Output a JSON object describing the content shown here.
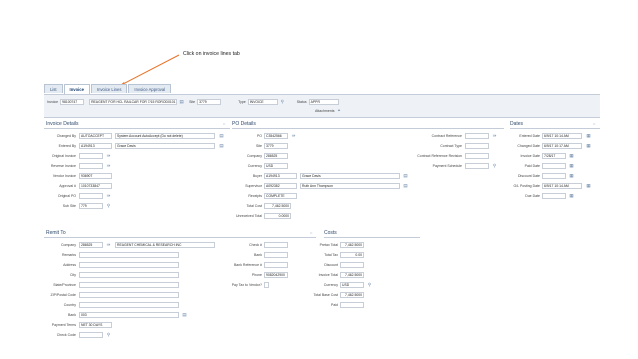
{
  "annotation": "Click on invoice lines tab",
  "tabs": [
    "List",
    "Invoice",
    "Invoice Lines",
    "Invoice Approval"
  ],
  "header": {
    "invoice_label": "Invoice",
    "invoice_value": "98100747",
    "description_value": "REAGENT FOR HCL RAILCAR FOR 7/15 ROROD0101",
    "site_label": "Site",
    "site_value": "3779",
    "type_label": "Type",
    "type_value": "INVOICE",
    "status_label": "Status",
    "status_value": "APPR",
    "attachments_label": "Attachments"
  },
  "invoice_details": {
    "title": "Invoice Details",
    "changed_by_label": "Changed By",
    "changed_by_value": "AUTOACCEPT",
    "changed_by_desc": "System Account AutoAccept (Do not delete)",
    "entered_by_label": "Entered By",
    "entered_by_value": "A194913",
    "entered_by_desc": "Grace Davis",
    "original_invoice_label": "Original Invoice",
    "reverse_invoice_label": "Reverse Invoice",
    "vendor_invoice_label": "Vendor Invoice",
    "vendor_invoice_value": "93690T",
    "approval_label": "Approval #",
    "approval_value": "1010733847",
    "original_po_label": "Original PO",
    "sub_site_label": "Sub Site",
    "sub_site_value": "779"
  },
  "po_details": {
    "title": "PO Details",
    "po_label": "PO",
    "po_value": "C3542566",
    "site_label": "Site",
    "site_value": "3779",
    "company_label": "Company",
    "company_value": "286525",
    "currency_label": "Currency",
    "currency_value": "USD",
    "buyer_label": "Buyer",
    "buyer_value": "A194913",
    "buyer_desc": "Grace Davis",
    "supervisor_label": "Supervisor",
    "supervisor_value": "A092382",
    "supervisor_desc": "Ruth Ann Thompson",
    "receipts_label": "Receipts",
    "receipts_value": "COMPLETE",
    "total_cost_label": "Total Cost",
    "total_cost_value": "7,462.5000",
    "unreceived_total_label": "Unreceived Total",
    "unreceived_total_value": "0.0000",
    "contract_reference_label": "Contract Reference",
    "contract_type_label": "Contract Type",
    "contract_revision_label": "Contract Reference Revision",
    "payment_schedule_label": "Payment Schedule"
  },
  "dates": {
    "title": "Dates",
    "entered_date_label": "Entered Date",
    "entered_date_value": "6/9/17 10:14 AM",
    "changed_date_label": "Changed Date",
    "changed_date_value": "6/9/17 10:17 AM",
    "invoice_date_label": "Invoice Date",
    "invoice_date_value": "7/28/17",
    "paid_date_label": "Paid Date",
    "discount_date_label": "Discount Date",
    "gl_posting_date_label": "G/L Posting Date",
    "gl_posting_date_value": "6/9/17 10:14 AM",
    "due_date_label": "Due Date"
  },
  "remit_to": {
    "title": "Remit To",
    "company_label": "Company",
    "company_value": "286525",
    "company_desc": "REAGENT CHEMICAL & RESEARCH INC",
    "remarks_label": "Remarks",
    "address_label": "Address",
    "city_label": "City",
    "state_label": "State/Province",
    "zip_label": "ZIP/Postal Code",
    "country_label": "Country",
    "bank_label": "Bank",
    "bank_value": "003",
    "payment_terms_label": "Payment Terms",
    "payment_terms_value": "NET 30 DAYS",
    "check_code_label": "Check Code",
    "check_label": "Check #",
    "bank2_label": "Bank",
    "bank_reference_label": "Bank Reference #",
    "phone_label": "Phone",
    "phone_value": "9082042900",
    "pay_tax_label": "Pay Tax to Vendor?"
  },
  "costs": {
    "title": "Costs",
    "pretax_label": "Pretax Total",
    "pretax_value": "7,462.5000",
    "total_tax_label": "Total Tax",
    "total_tax_value": "0.00",
    "discount_label": "Discount",
    "invoice_total_label": "Invoice Total",
    "invoice_total_value": "7,462.5000",
    "currency_label": "Currency",
    "currency_value": "USD",
    "total_base_cost_label": "Total Base Cost",
    "total_base_cost_value": "7,462.5000",
    "paid_label": "Paid"
  },
  "colors": {
    "accent": "#e8742a",
    "header_bg": "#eef2f7",
    "tab_active": "#1b3f6e"
  }
}
